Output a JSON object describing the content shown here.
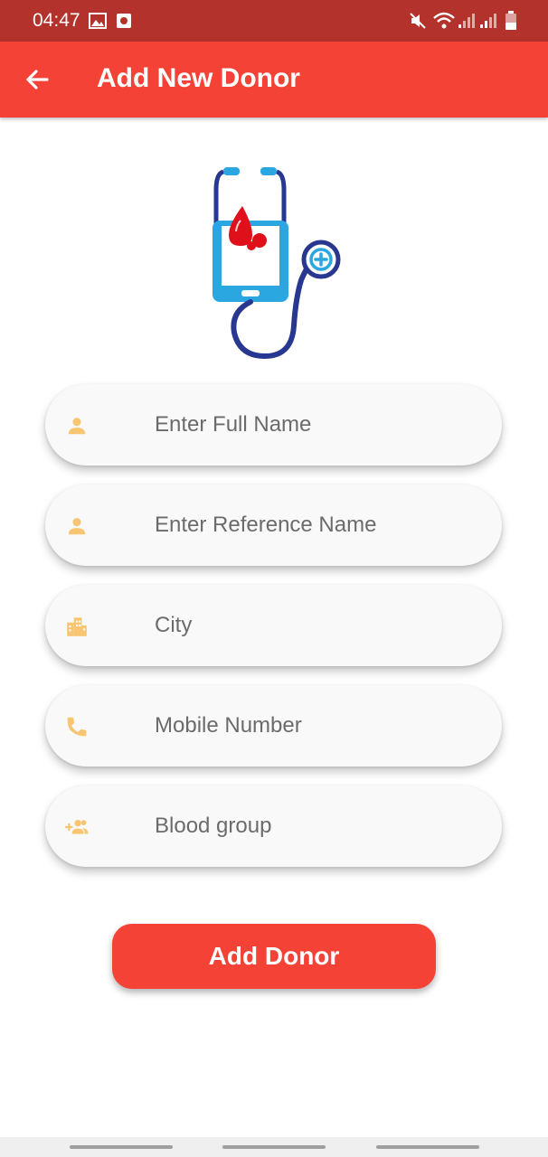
{
  "status_bar": {
    "time": "04:47",
    "left_icons": [
      "image-icon",
      "camera-icon"
    ],
    "right_icons": [
      "mute-icon",
      "wifi-icon",
      "signal-1-icon",
      "signal-2-icon",
      "battery-icon"
    ]
  },
  "app_bar": {
    "title": "Add New Donor",
    "back_icon": "arrow-back-icon",
    "color": "#f44336"
  },
  "logo_icon": "stethoscope-phone-blood-drop",
  "form": {
    "fields": [
      {
        "placeholder": "Enter Full Name",
        "value": "",
        "icon": "person-icon"
      },
      {
        "placeholder": "Enter Reference Name",
        "value": "",
        "icon": "person-icon"
      },
      {
        "placeholder": "City",
        "value": "",
        "icon": "city-icon"
      },
      {
        "placeholder": "Mobile Number",
        "value": "",
        "icon": "phone-icon"
      },
      {
        "placeholder": "Blood group",
        "value": "",
        "icon": "group-add-icon"
      }
    ],
    "icon_color": "#f8c572"
  },
  "submit_label": "Add Donor",
  "colors": {
    "status_bar": "#b3322b",
    "primary": "#f44336",
    "logo_blue": "#2aa7e0",
    "logo_navy": "#28378f",
    "blood_red": "#e0101a"
  }
}
